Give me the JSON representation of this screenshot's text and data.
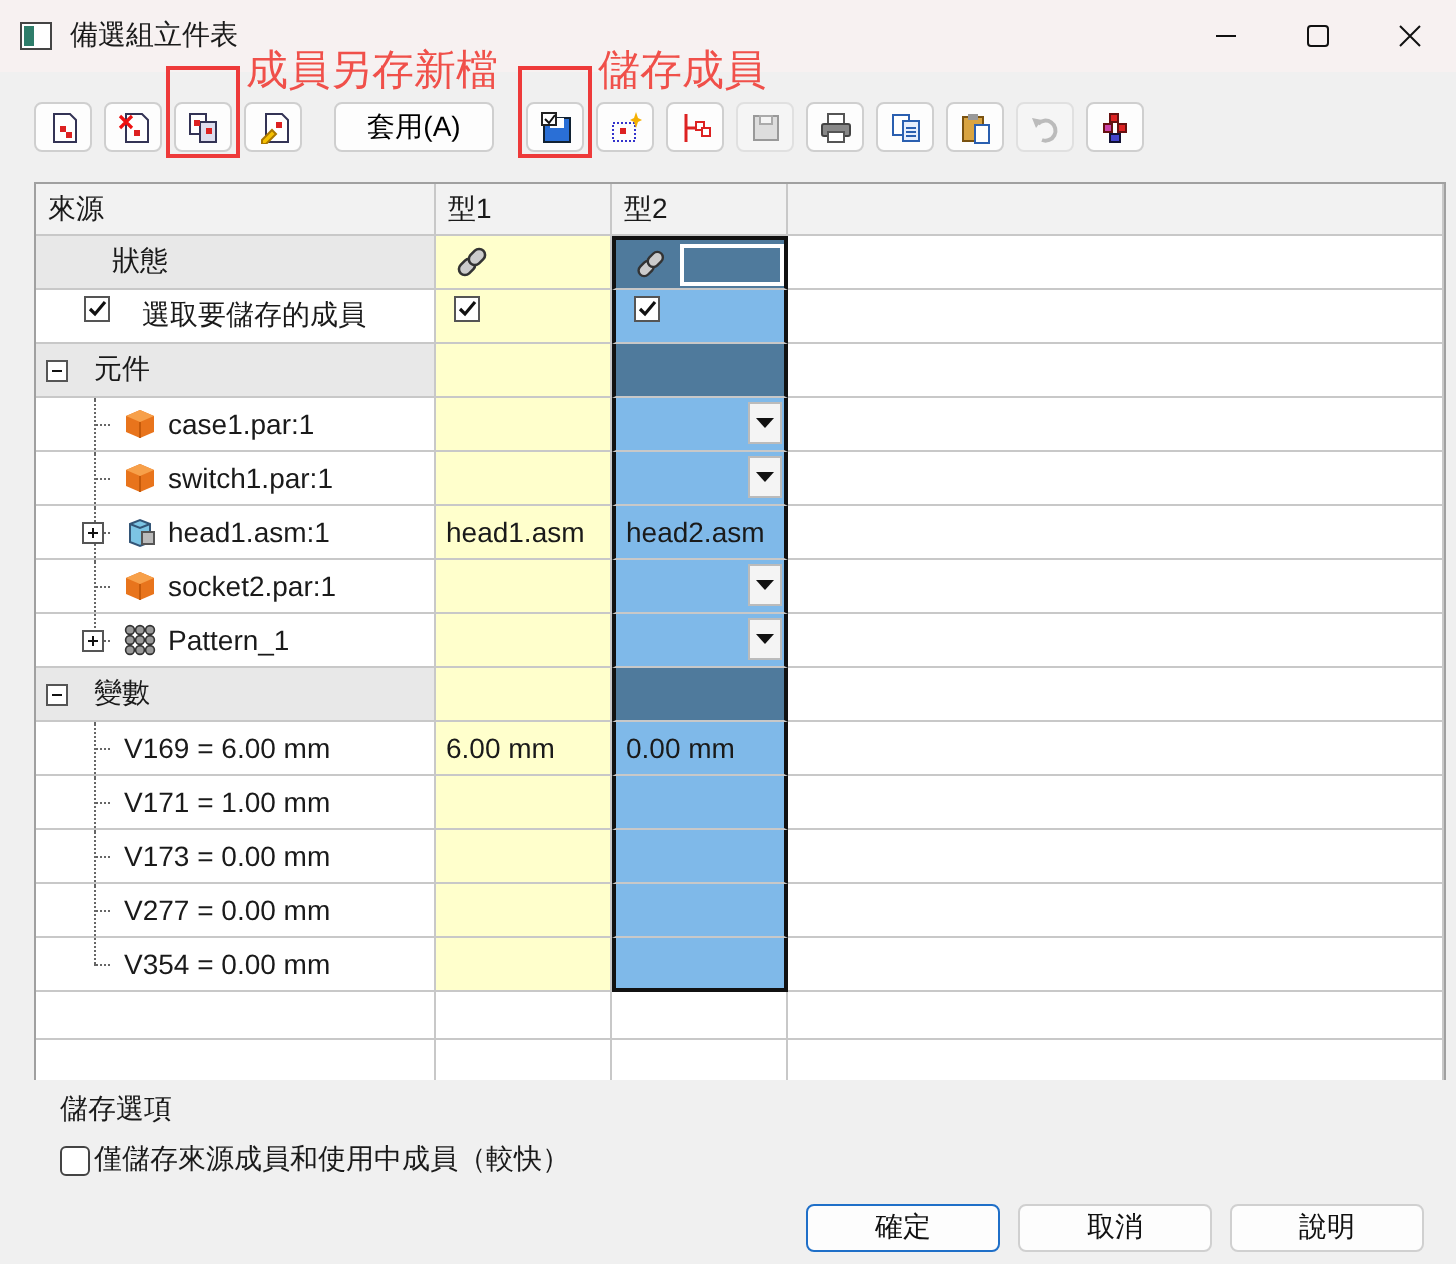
{
  "window": {
    "title": "備選組立件表"
  },
  "toolbar": [
    {
      "kind": "icon",
      "disabled": false,
      "highlighted": false
    },
    {
      "kind": "icon",
      "disabled": false,
      "highlighted": false
    },
    {
      "kind": "icon",
      "disabled": false,
      "highlighted": true,
      "annotation": "成員另存新檔"
    },
    {
      "kind": "icon",
      "disabled": false,
      "highlighted": false
    },
    {
      "kind": "text",
      "label": "套用(A)",
      "disabled": false,
      "highlighted": false
    },
    {
      "kind": "icon",
      "disabled": false,
      "highlighted": true,
      "annotation": "儲存成員"
    },
    {
      "kind": "icon",
      "disabled": false,
      "highlighted": false
    },
    {
      "kind": "icon",
      "disabled": false,
      "highlighted": false
    },
    {
      "kind": "icon",
      "disabled": true,
      "highlighted": false
    },
    {
      "kind": "icon",
      "disabled": false,
      "highlighted": false
    },
    {
      "kind": "icon",
      "disabled": false,
      "highlighted": false
    },
    {
      "kind": "icon",
      "disabled": false,
      "highlighted": false
    },
    {
      "kind": "icon",
      "disabled": true,
      "highlighted": false
    },
    {
      "kind": "icon",
      "disabled": false,
      "highlighted": false
    }
  ],
  "table": {
    "columns": [
      {
        "label": "來源"
      },
      {
        "label": "型1",
        "selected": false
      },
      {
        "label": "型2",
        "selected": true
      }
    ],
    "rows": [
      {
        "kind": "status",
        "label": "狀態",
        "cells": [
          {
            "linked": true
          },
          {
            "linked": true
          }
        ]
      },
      {
        "kind": "select",
        "label": "選取要儲存的成員",
        "checked": true,
        "cells": [
          {
            "checked": true
          },
          {
            "checked": true
          }
        ]
      },
      {
        "kind": "group",
        "label": "元件",
        "expanded": true,
        "children": [
          {
            "kind": "part",
            "label": "case1.par:1",
            "expandable": false,
            "cells": [
              {
                "dropdown": false
              },
              {
                "dropdown": true
              }
            ]
          },
          {
            "kind": "part",
            "label": "switch1.par:1",
            "expandable": false,
            "cells": [
              {
                "dropdown": false
              },
              {
                "dropdown": true
              }
            ]
          },
          {
            "kind": "assembly",
            "label": "head1.asm:1",
            "expandable": true,
            "cells": [
              {
                "text": "head1.asm",
                "dropdown": false
              },
              {
                "text": "head2.asm",
                "dropdown": false
              }
            ]
          },
          {
            "kind": "part",
            "label": "socket2.par:1",
            "expandable": false,
            "cells": [
              {
                "dropdown": false
              },
              {
                "dropdown": true
              }
            ]
          },
          {
            "kind": "pattern",
            "label": "Pattern_1",
            "expandable": true,
            "cells": [
              {
                "dropdown": false
              },
              {
                "dropdown": true
              }
            ]
          }
        ]
      },
      {
        "kind": "group",
        "label": "變數",
        "expanded": true,
        "children": [
          {
            "kind": "variable",
            "label": "V169 = 6.00 mm",
            "expandable": false,
            "cells": [
              {
                "text": "6.00 mm",
                "dropdown": false
              },
              {
                "text": "0.00 mm",
                "dropdown": false
              }
            ]
          },
          {
            "kind": "variable",
            "label": "V171 = 1.00 mm",
            "expandable": false,
            "cells": [
              {
                "dropdown": false
              },
              {
                "dropdown": false
              }
            ]
          },
          {
            "kind": "variable",
            "label": "V173 = 0.00 mm",
            "expandable": false,
            "cells": [
              {
                "dropdown": false
              },
              {
                "dropdown": false
              }
            ]
          },
          {
            "kind": "variable",
            "label": "V277 = 0.00 mm",
            "expandable": false,
            "cells": [
              {
                "dropdown": false
              },
              {
                "dropdown": false
              }
            ]
          },
          {
            "kind": "variable",
            "label": "V354 = 0.00 mm",
            "expandable": false,
            "cells": [
              {
                "dropdown": false
              },
              {
                "dropdown": false
              }
            ]
          }
        ]
      }
    ]
  },
  "save_options": {
    "title": "儲存選項",
    "option": {
      "label": "僅儲存來源成員和使用中成員（較快）",
      "checked": false
    }
  },
  "buttons": [
    {
      "label": "確定",
      "default": true
    },
    {
      "label": "取消",
      "default": false
    },
    {
      "label": "說明",
      "default": false
    }
  ]
}
